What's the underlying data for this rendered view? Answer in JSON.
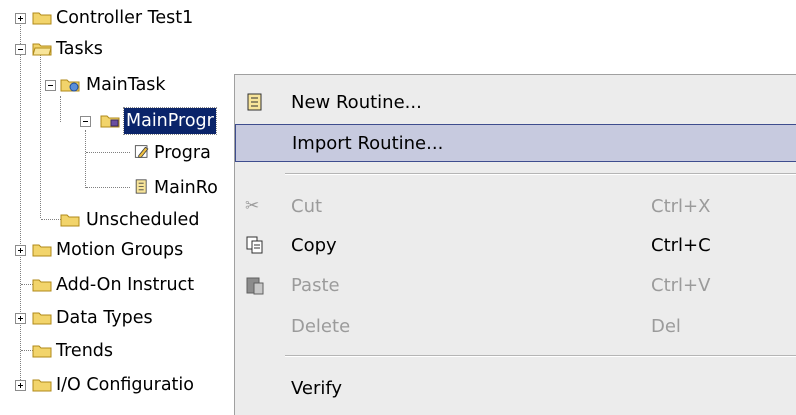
{
  "tree": {
    "items": [
      {
        "label": "Controller Test1"
      },
      {
        "label": "Tasks"
      },
      {
        "label": "MainTask"
      },
      {
        "label": "MainProgr"
      },
      {
        "label": "Progra"
      },
      {
        "label": "MainRo"
      },
      {
        "label": "Unscheduled"
      },
      {
        "label": "Motion Groups"
      },
      {
        "label": "Add-On Instruct"
      },
      {
        "label": "Data Types"
      },
      {
        "label": "Trends"
      },
      {
        "label": "I/O Configuratio"
      }
    ]
  },
  "context_menu": {
    "items": [
      {
        "label": "New Routine...",
        "shortcut": "",
        "icon": "new-routine-icon",
        "enabled": true
      },
      {
        "label": "Import Routine...",
        "shortcut": "",
        "icon": "",
        "enabled": true,
        "highlighted": true
      },
      {
        "label": "Cut",
        "shortcut": "Ctrl+X",
        "icon": "scissors-icon",
        "enabled": false
      },
      {
        "label": "Copy",
        "shortcut": "Ctrl+C",
        "icon": "copy-icon",
        "enabled": true
      },
      {
        "label": "Paste",
        "shortcut": "Ctrl+V",
        "icon": "paste-icon",
        "enabled": false
      },
      {
        "label": "Delete",
        "shortcut": "Del",
        "icon": "",
        "enabled": false
      },
      {
        "label": "Verify",
        "shortcut": "",
        "icon": "",
        "enabled": true
      }
    ]
  },
  "colors": {
    "selection": "#0a246a",
    "menu_bg": "#ececec",
    "menu_highlight": "#c7cadf",
    "folder": "#f2d46b"
  }
}
